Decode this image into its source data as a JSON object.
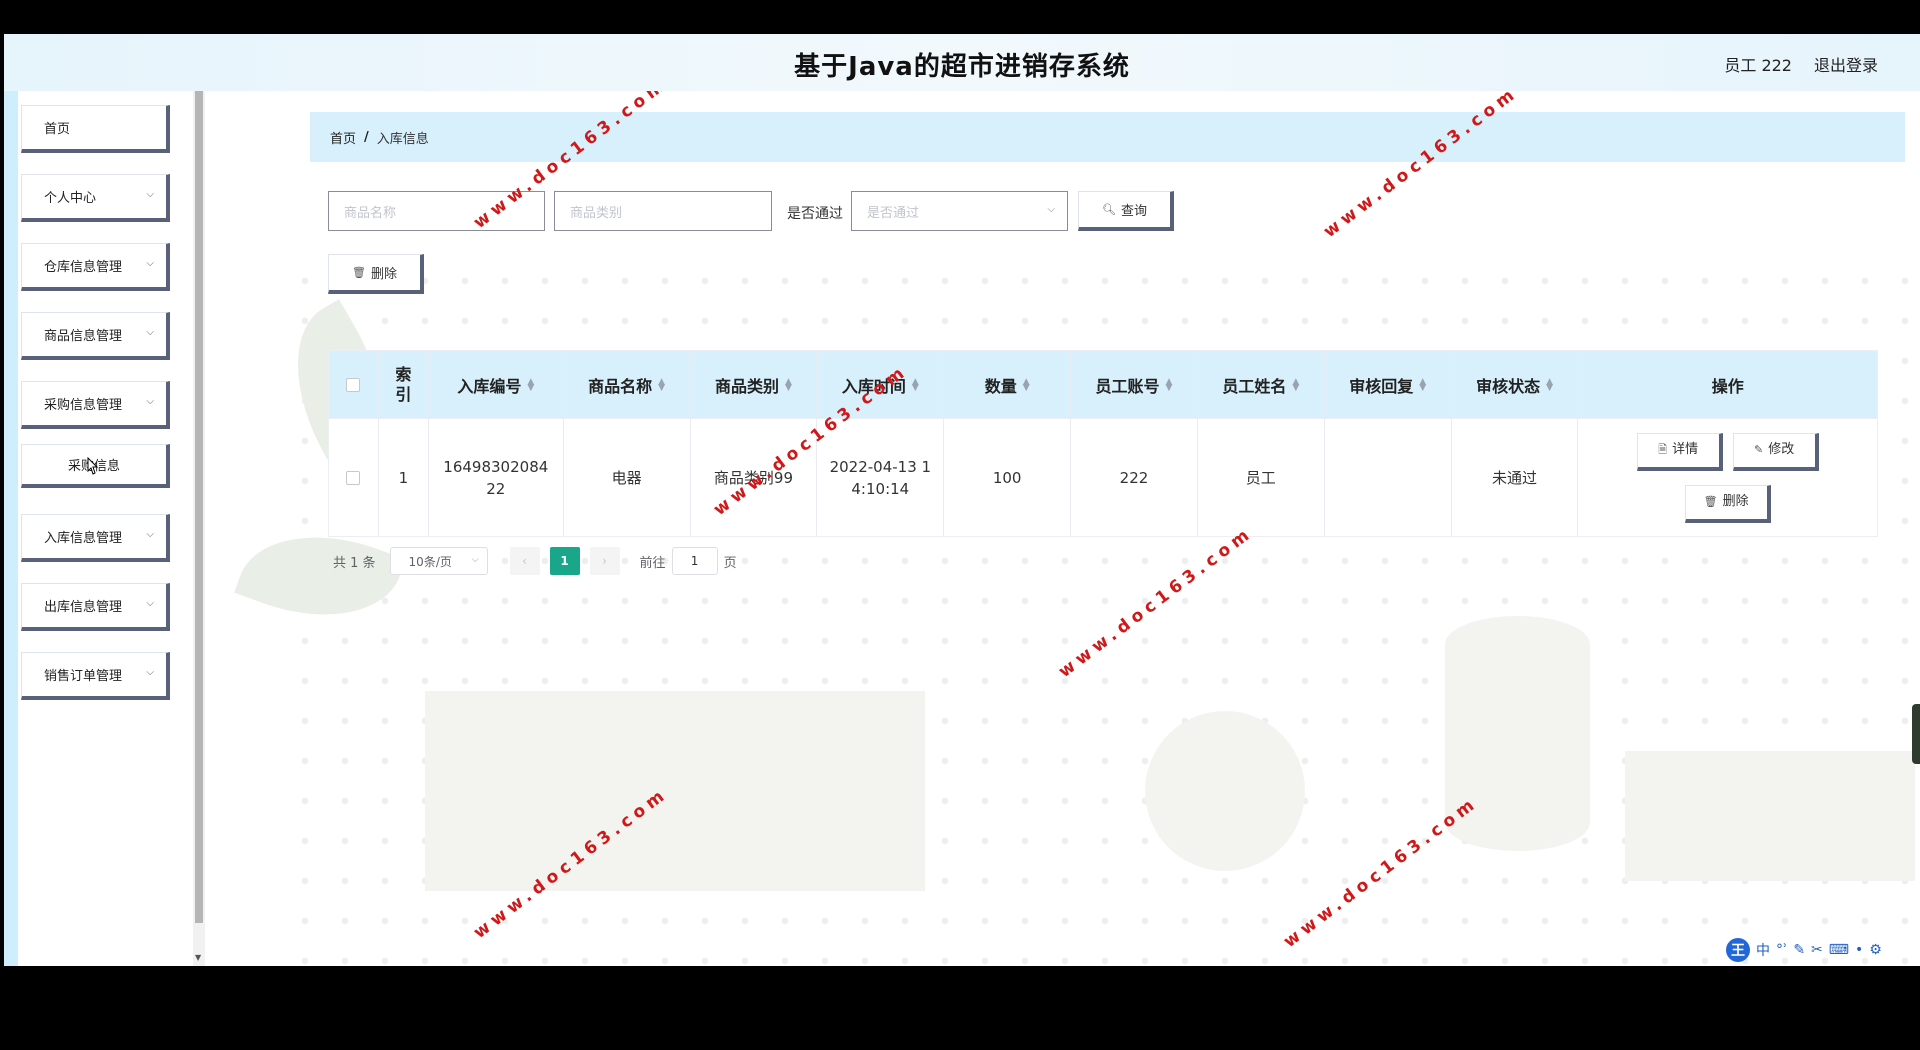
{
  "header": {
    "title": "基于Java的超市进销存系统",
    "user": "员工 222",
    "logout": "退出登录"
  },
  "sidebar": {
    "items": [
      {
        "label": "首页",
        "chevron": false
      },
      {
        "label": "个人中心",
        "chevron": true
      },
      {
        "label": "仓库信息管理",
        "chevron": true
      },
      {
        "label": "商品信息管理",
        "chevron": true
      },
      {
        "label": "采购信息管理",
        "chevron": true
      },
      {
        "label": "入库信息管理",
        "chevron": true
      },
      {
        "label": "出库信息管理",
        "chevron": true
      },
      {
        "label": "销售订单管理",
        "chevron": true
      }
    ],
    "sub_item": "采购信息"
  },
  "breadcrumb": {
    "home": "首页",
    "separator": "/",
    "current": "入库信息"
  },
  "filters": {
    "name_placeholder": "商品名称",
    "category_placeholder": "商品类别",
    "passed_label": "是否通过",
    "passed_placeholder": "是否通过",
    "search_label": "查询",
    "delete_label": "删除"
  },
  "table": {
    "columns": [
      "索引",
      "入库编号",
      "商品名称",
      "商品类别",
      "入库时间",
      "数量",
      "员工账号",
      "员工姓名",
      "审核回复",
      "审核状态",
      "操作"
    ],
    "rows": [
      {
        "index": "1",
        "code": "1649830208422",
        "name": "电器",
        "category": "商品类别99",
        "time": "2022-04-13 14:10:14",
        "qty": "100",
        "account": "222",
        "staff": "员工",
        "reply": "",
        "status": "未通过",
        "detail_label": "详情",
        "edit_label": "修改",
        "delete_label": "删除"
      }
    ]
  },
  "pagination": {
    "total": "共 1 条",
    "page_size": "10条/页",
    "current_page": "1",
    "goto_label": "前往",
    "goto_value": "1",
    "page_suffix": "页"
  },
  "watermark": "www.doc163.com",
  "ime": {
    "logo": "王",
    "mode": "中"
  },
  "colors": {
    "accent": "#1aa68a",
    "header_bg": "#e6f4fb",
    "table_head": "#d7f0fc",
    "watermark": "#d01818"
  }
}
